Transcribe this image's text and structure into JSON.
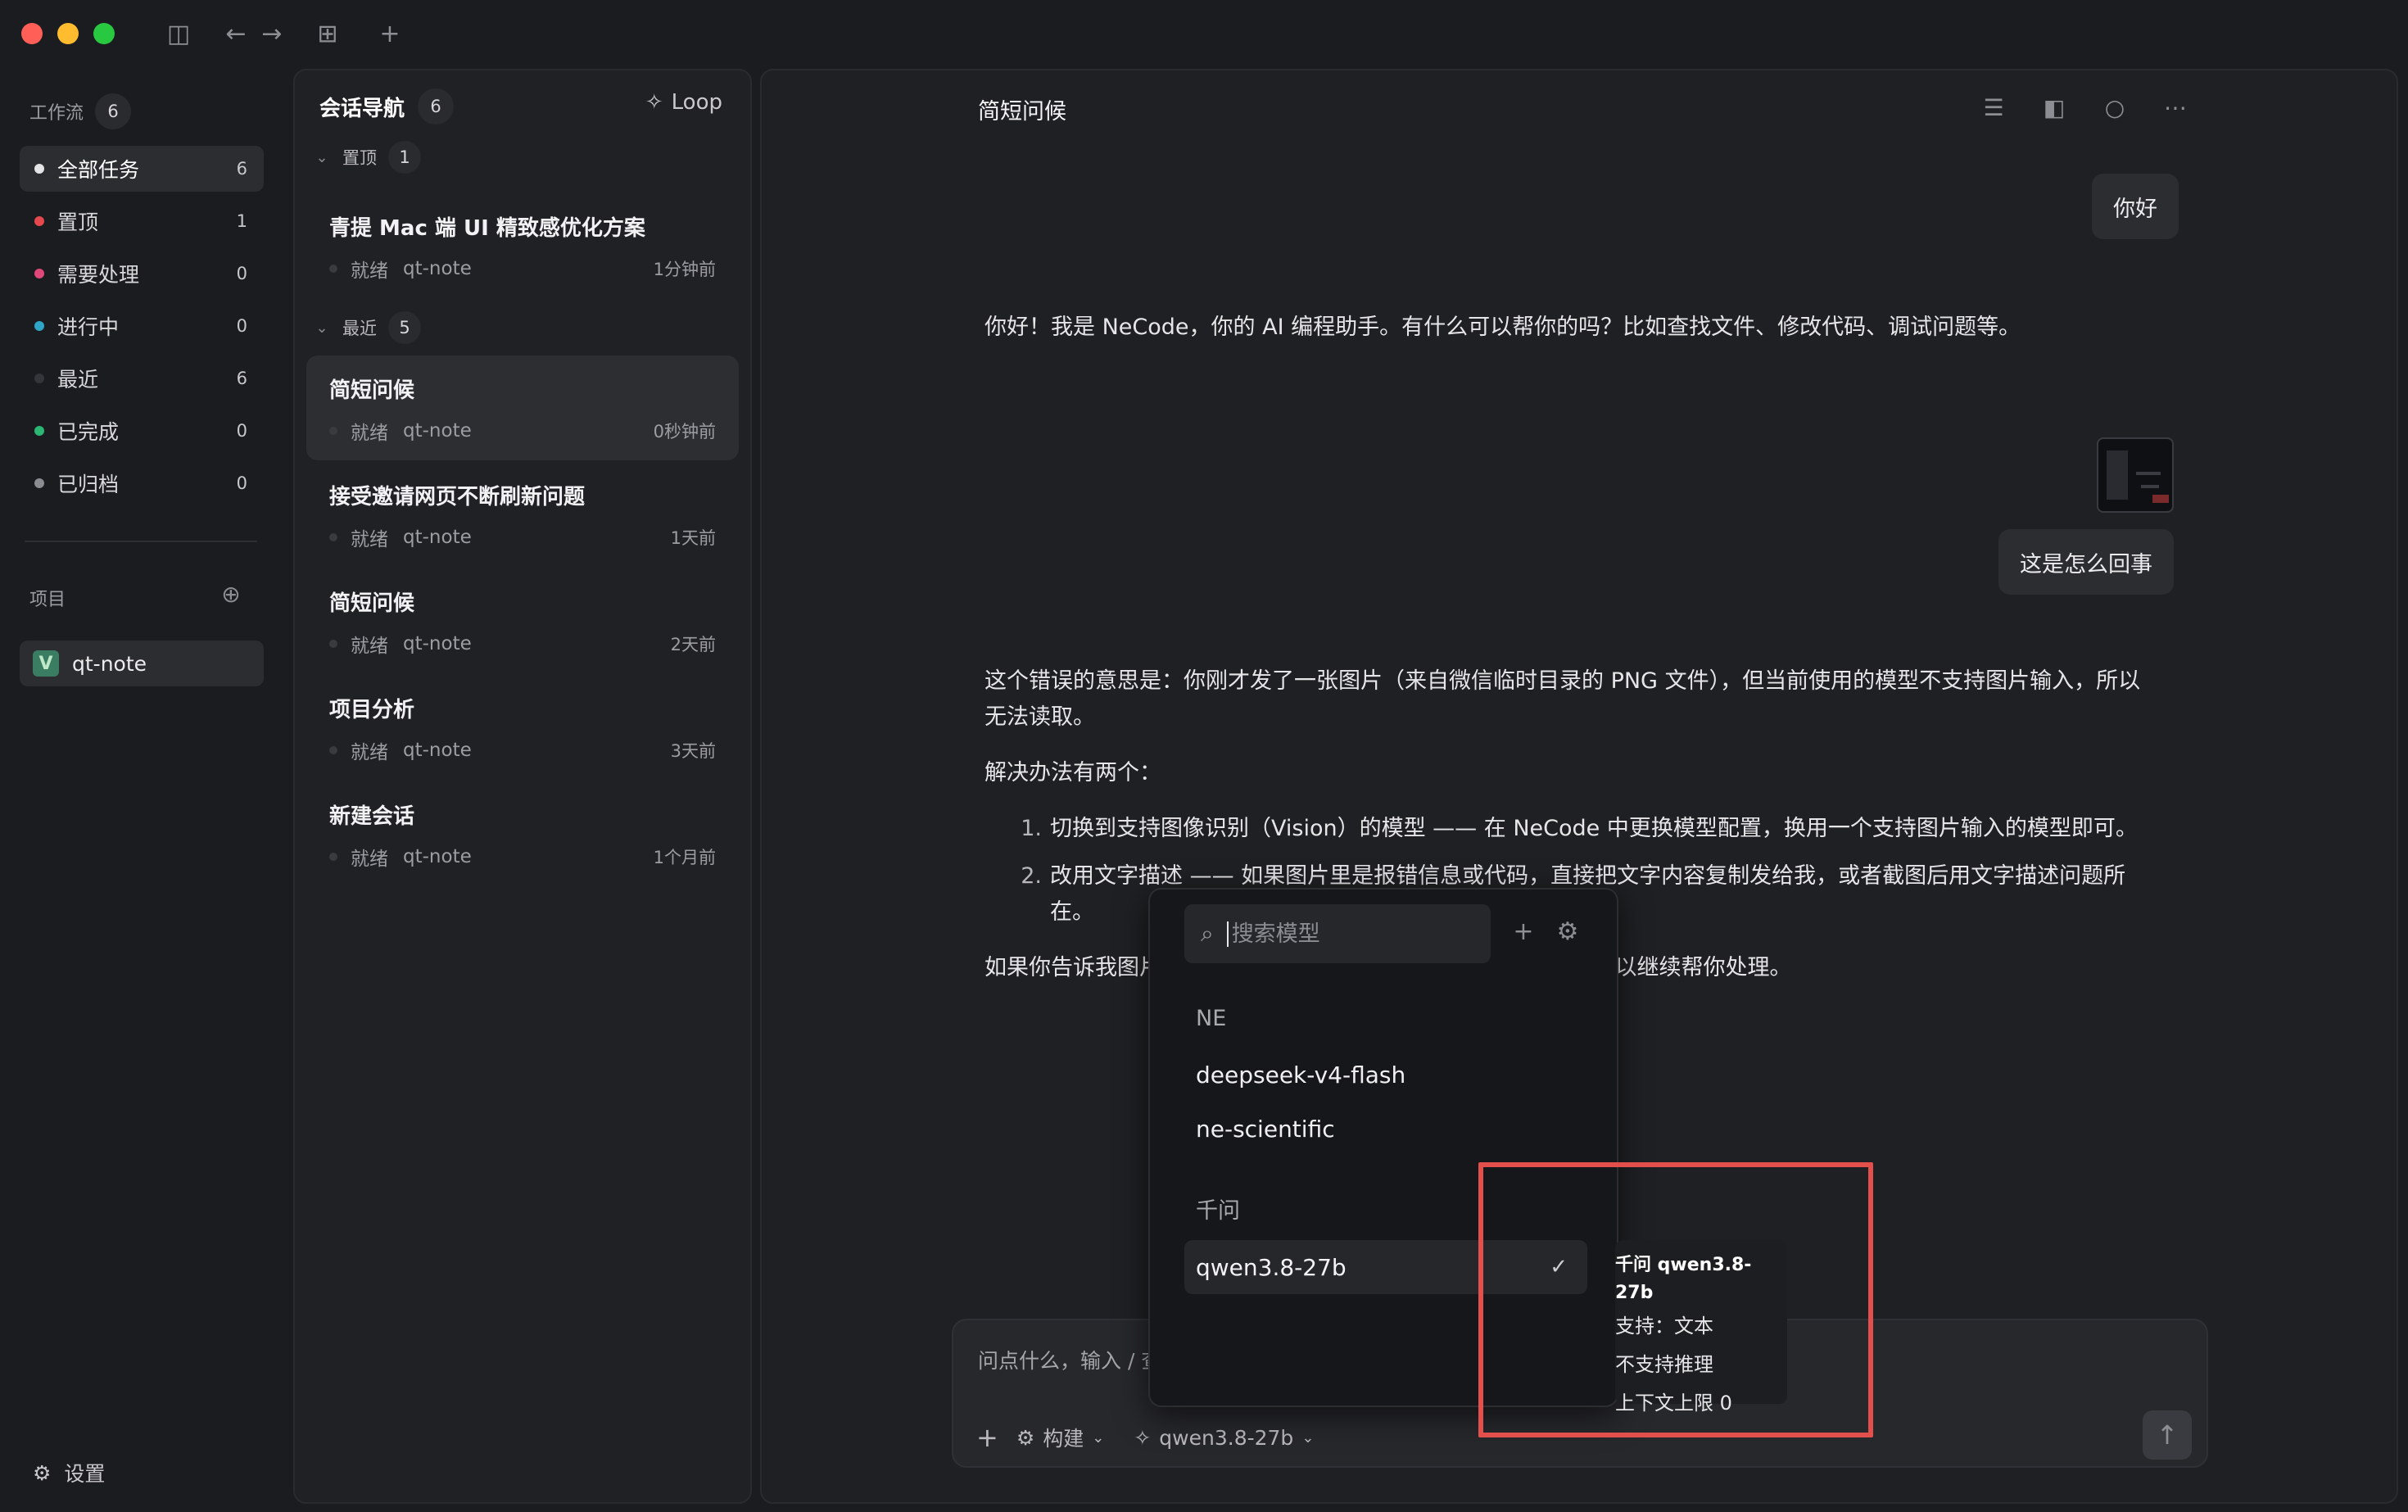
{
  "sidebar": {
    "workflow_label": "工作流",
    "workflow_count": "6",
    "filters": [
      {
        "label": "全部任务",
        "count": "6",
        "color": "#e4e4e6"
      },
      {
        "label": "置顶",
        "count": "1",
        "color": "#e5484d"
      },
      {
        "label": "需要处理",
        "count": "0",
        "color": "#e0487a"
      },
      {
        "label": "进行中",
        "count": "0",
        "color": "#2fa6c8"
      },
      {
        "label": "最近",
        "count": "6",
        "color": "#34353a"
      },
      {
        "label": "已完成",
        "count": "0",
        "color": "#2bb673"
      },
      {
        "label": "已归档",
        "count": "0",
        "color": "#8b8c91"
      }
    ],
    "projects_label": "项目",
    "project": {
      "name": "qt-note",
      "logo": "V"
    },
    "settings_label": "设置"
  },
  "sessions": {
    "title": "会话导航",
    "count": "6",
    "loop_label": "Loop",
    "pinned": {
      "label": "置顶",
      "count": "1"
    },
    "recent": {
      "label": "最近",
      "count": "5"
    },
    "items": [
      {
        "title": "青提 Mac 端 UI 精致感优化方案",
        "status": "就绪",
        "project": "qt-note",
        "time": "1分钟前"
      },
      {
        "title": "简短问候",
        "status": "就绪",
        "project": "qt-note",
        "time": "0秒钟前"
      },
      {
        "title": "接受邀请网页不断刷新问题",
        "status": "就绪",
        "project": "qt-note",
        "time": "1天前"
      },
      {
        "title": "简短问候",
        "status": "就绪",
        "project": "qt-note",
        "time": "2天前"
      },
      {
        "title": "项目分析",
        "status": "就绪",
        "project": "qt-note",
        "time": "3天前"
      },
      {
        "title": "新建会话",
        "status": "就绪",
        "project": "qt-note",
        "time": "1个月前"
      }
    ]
  },
  "chat": {
    "title": "简短问候",
    "user_msg_1": "你好",
    "assistant_msg_1": "你好！我是 NeCode，你的 AI 编程助手。有什么可以帮你的吗？比如查找文件、修改代码、调试问题等。",
    "user_msg_2": "这是怎么回事",
    "assistant_msg_2_p1": "这个错误的意思是：你刚才发了一张图片（来自微信临时目录的 PNG 文件），但当前使用的模型不支持图片输入，所以无法读取。",
    "assistant_msg_2_p2": "解决办法有两个：",
    "list": [
      {
        "num": "1.",
        "text": "切换到支持图像识别（Vision）的模型 —— 在 NeCode 中更换模型配置，换用一个支持图片输入的模型即可。"
      },
      {
        "num": "2.",
        "text": "改用文字描述 —— 如果图片里是报错信息或代码，直接把文字内容复制发给我，或者截图后用文字描述问题所在。"
      }
    ],
    "assistant_msg_2_p3": "如果你告诉我图片里的内容（比如报错信息、代码片段等），我可以继续帮你处理。"
  },
  "composer": {
    "placeholder": "问点什么，输入 / 查看命令",
    "mode_label": "构建",
    "model_label": "qwen3.8-27b"
  },
  "model_picker": {
    "search_placeholder": "搜索模型",
    "groups": [
      {
        "name": "NE",
        "models": [
          "deepseek-v4-flash",
          "ne-scientific"
        ]
      },
      {
        "name": "千问",
        "models": [
          "qwen3.8-27b"
        ]
      }
    ],
    "selected": "qwen3.8-27b",
    "tooltip": {
      "title": "千问 qwen3.8-27b",
      "support": "支持：文本",
      "reasoning": "不支持推理",
      "context": "上下文上限 0"
    }
  }
}
